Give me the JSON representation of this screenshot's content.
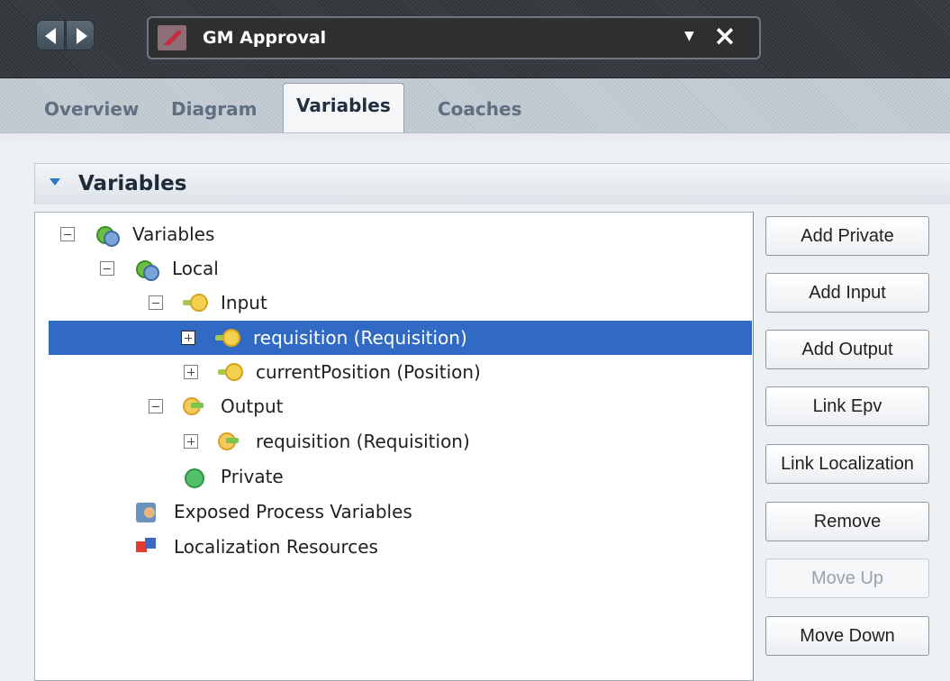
{
  "header": {
    "title": "GM Approval",
    "back_icon": "back-icon",
    "forward_icon": "forward-icon",
    "dropdown_icon": "dropdown-icon",
    "close_icon": "close-icon"
  },
  "tabs": [
    {
      "label": "Overview",
      "active": false
    },
    {
      "label": "Diagram",
      "active": false
    },
    {
      "label": "Variables",
      "active": true
    },
    {
      "label": "Coaches",
      "active": false
    }
  ],
  "section": {
    "title": "Variables"
  },
  "tree": [
    {
      "label": "Variables"
    },
    {
      "label": "Local"
    },
    {
      "label": "Input"
    },
    {
      "label": "requisition (Requisition)"
    },
    {
      "label": "currentPosition (Position)"
    },
    {
      "label": "Output"
    },
    {
      "label": "requisition (Requisition)"
    },
    {
      "label": "Private"
    },
    {
      "label": "Exposed Process Variables"
    },
    {
      "label": "Localization Resources"
    }
  ],
  "buttons": {
    "add_private": "Add Private",
    "add_input": "Add Input",
    "add_output": "Add Output",
    "link_epv": "Link Epv",
    "link_localization": "Link Localization",
    "remove": "Remove",
    "move_up": "Move Up",
    "move_down": "Move Down"
  },
  "colors": {
    "selection": "#316ac5",
    "header_background": "#2c3136",
    "active_tab": "#f4f6f8",
    "section_chevron": "#2a78c7"
  }
}
